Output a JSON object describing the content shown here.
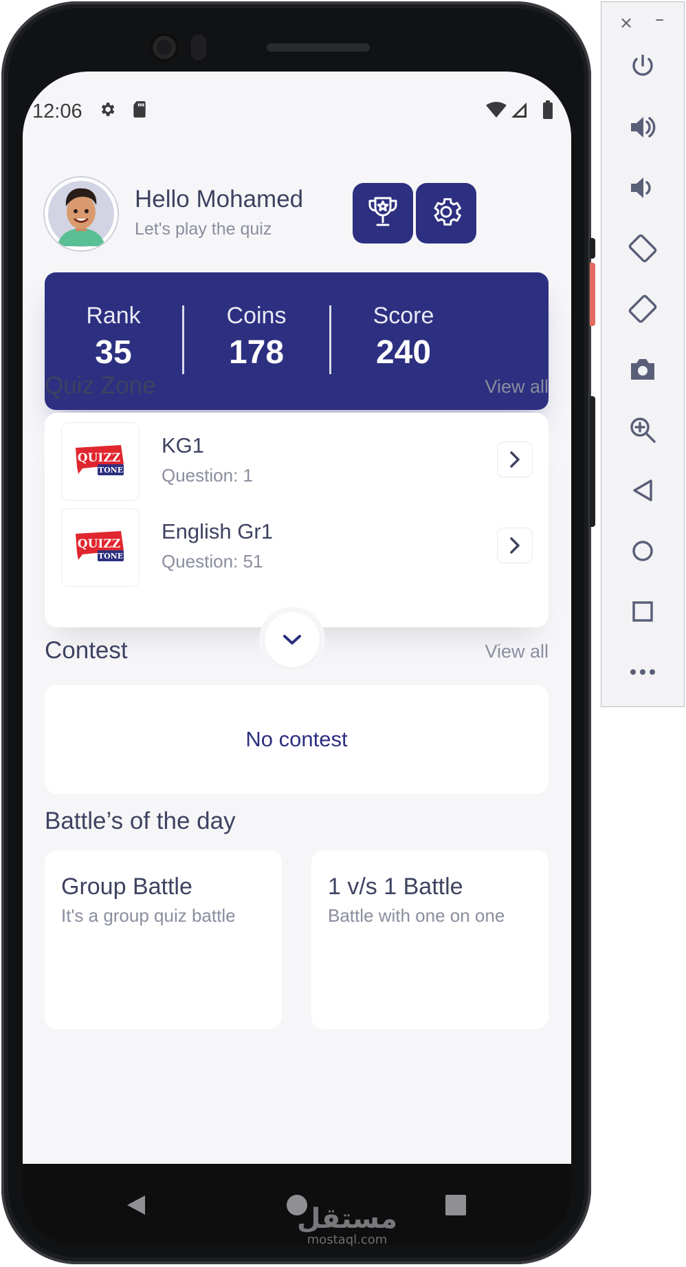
{
  "status_bar": {
    "time": "12:06"
  },
  "header": {
    "greeting": "Hello Mohamed",
    "subtitle": "Let's play the quiz"
  },
  "stats": [
    {
      "label": "Rank",
      "value": "35"
    },
    {
      "label": "Coins",
      "value": "178"
    },
    {
      "label": "Score",
      "value": "240"
    }
  ],
  "quiz_zone": {
    "title": "Quiz Zone",
    "view_all": "View all",
    "items": [
      {
        "name": "KG1",
        "subtitle": "Question: 1",
        "logo_text": "QUIZZ",
        "logo_sub": "TONE"
      },
      {
        "name": "English Gr1",
        "subtitle": "Question: 51",
        "logo_text": "QUIZZ",
        "logo_sub": "TONE"
      }
    ]
  },
  "contest": {
    "title": "Contest",
    "view_all": "View all",
    "empty_text": "No contest"
  },
  "battles": {
    "title": "Battle’s of the day",
    "items": [
      {
        "title": "Group Battle",
        "subtitle": "It's a group quiz battle"
      },
      {
        "title": "1 v/s 1 Battle",
        "subtitle": "Battle with one on one"
      }
    ]
  },
  "watermark": {
    "arabic": "مستقل",
    "latin": "mostaql.com"
  },
  "colors": {
    "primary": "#2d2f80",
    "text_dark": "#3e4260",
    "text_muted": "#8a8d9e",
    "background": "#f6f6f8",
    "logo_red": "#e0262f"
  },
  "emulator_panel": {
    "close_label": "×",
    "minimize_label": "–",
    "icons": [
      "power-icon",
      "volume-up-icon",
      "volume-down-icon",
      "rotate-left-icon",
      "rotate-right-icon",
      "camera-icon",
      "zoom-icon",
      "back-icon",
      "home-icon",
      "overview-icon",
      "more-icon"
    ]
  }
}
